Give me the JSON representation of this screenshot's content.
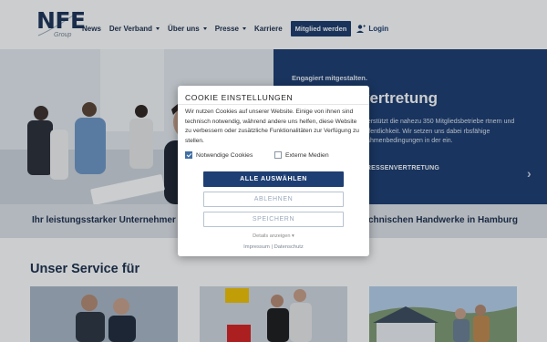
{
  "brand": {
    "logo_text": "NFE",
    "logo_sub": "Group"
  },
  "nav": {
    "items": [
      {
        "label": "News",
        "dropdown": false
      },
      {
        "label": "Der Verband",
        "dropdown": true
      },
      {
        "label": "Über uns",
        "dropdown": true
      },
      {
        "label": "Presse",
        "dropdown": true
      },
      {
        "label": "Karriere",
        "dropdown": false
      }
    ],
    "member_button": "Mitglied werden",
    "login": "Login"
  },
  "hero": {
    "kicker": "Engagiert mitgestalten.",
    "title": "vertretung",
    "text": "nterstützt die nahezu 350 Mitgliedsbetriebe rtnern und Öffentlichkeit. Wir setzen uns dabei rbsfähige Rahmenbedingungen in der ein.",
    "link": "ERESSENVERTRETUNG",
    "next_arrow": "›"
  },
  "band": {
    "left": "Ihr leistungsstarker Unternehmer",
    "right": "chnischen Handwerke in Hamburg"
  },
  "service": {
    "title": "Unser Service für"
  },
  "cookie": {
    "title": "COOKIE EINSTELLUNGEN",
    "text": "Wir nutzen Cookies auf unserer Website. Einige von ihnen sind technisch notwendig, während andere uns helfen, diese Website zu verbessern oder zusätzliche Funktionalitäten zur Verfügung zu stellen.",
    "options": [
      {
        "label": "Notwendige Cookies",
        "checked": true
      },
      {
        "label": "Externe Medien",
        "checked": false
      }
    ],
    "accept_all": "ALLE AUSWÄHLEN",
    "reject": "ABLEHNEN",
    "save": "SPEICHERN",
    "details": "Details anzeigen ▾",
    "impressum": "Impressum",
    "separator": "|",
    "datenschutz": "Datenschutz"
  },
  "colors": {
    "brand_blue": "#1b3b6f",
    "button_blue": "#1e3f73",
    "band_gray": "#dfe3e8"
  }
}
